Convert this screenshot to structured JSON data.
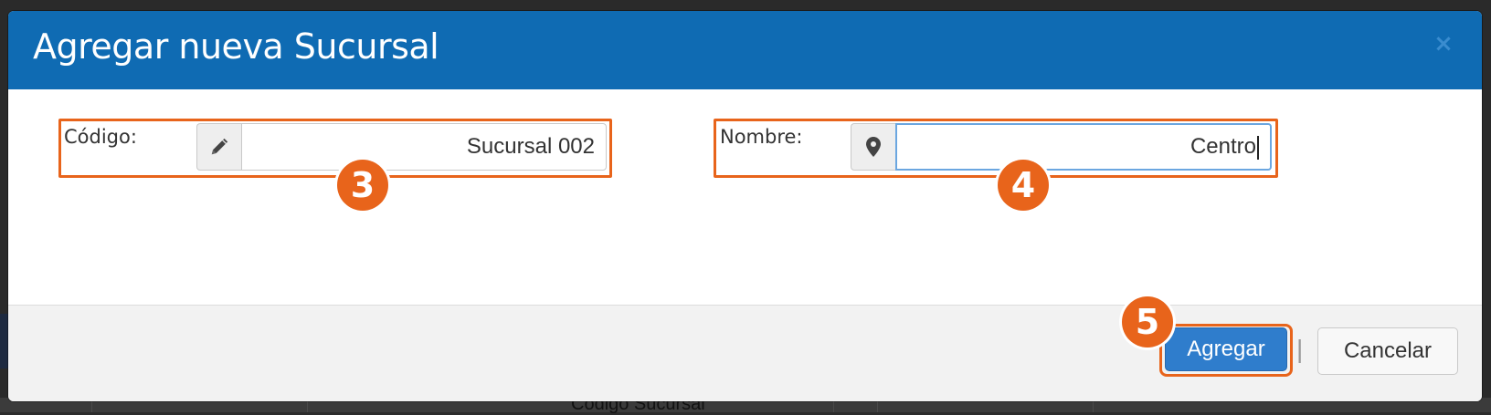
{
  "background": {
    "partial_text": "Código Sucursal"
  },
  "dialog": {
    "title": "Agregar nueva Sucursal",
    "close_glyph": "×",
    "fields": {
      "codigo": {
        "label": "Código:",
        "value": "Sucursal 002",
        "icon": "pencil-icon"
      },
      "nombre": {
        "label": "Nombre:",
        "value": "Centro",
        "icon": "map-marker-icon"
      }
    },
    "buttons": {
      "primary_label": "Agregar",
      "separator": "|",
      "cancel_label": "Cancelar"
    }
  },
  "annotations": {
    "step_codigo": "3",
    "step_nombre": "4",
    "step_agregar": "5"
  },
  "colors": {
    "header": "#0f6bb3",
    "highlight": "#e8641b",
    "primary_button": "#2f7dcc"
  }
}
